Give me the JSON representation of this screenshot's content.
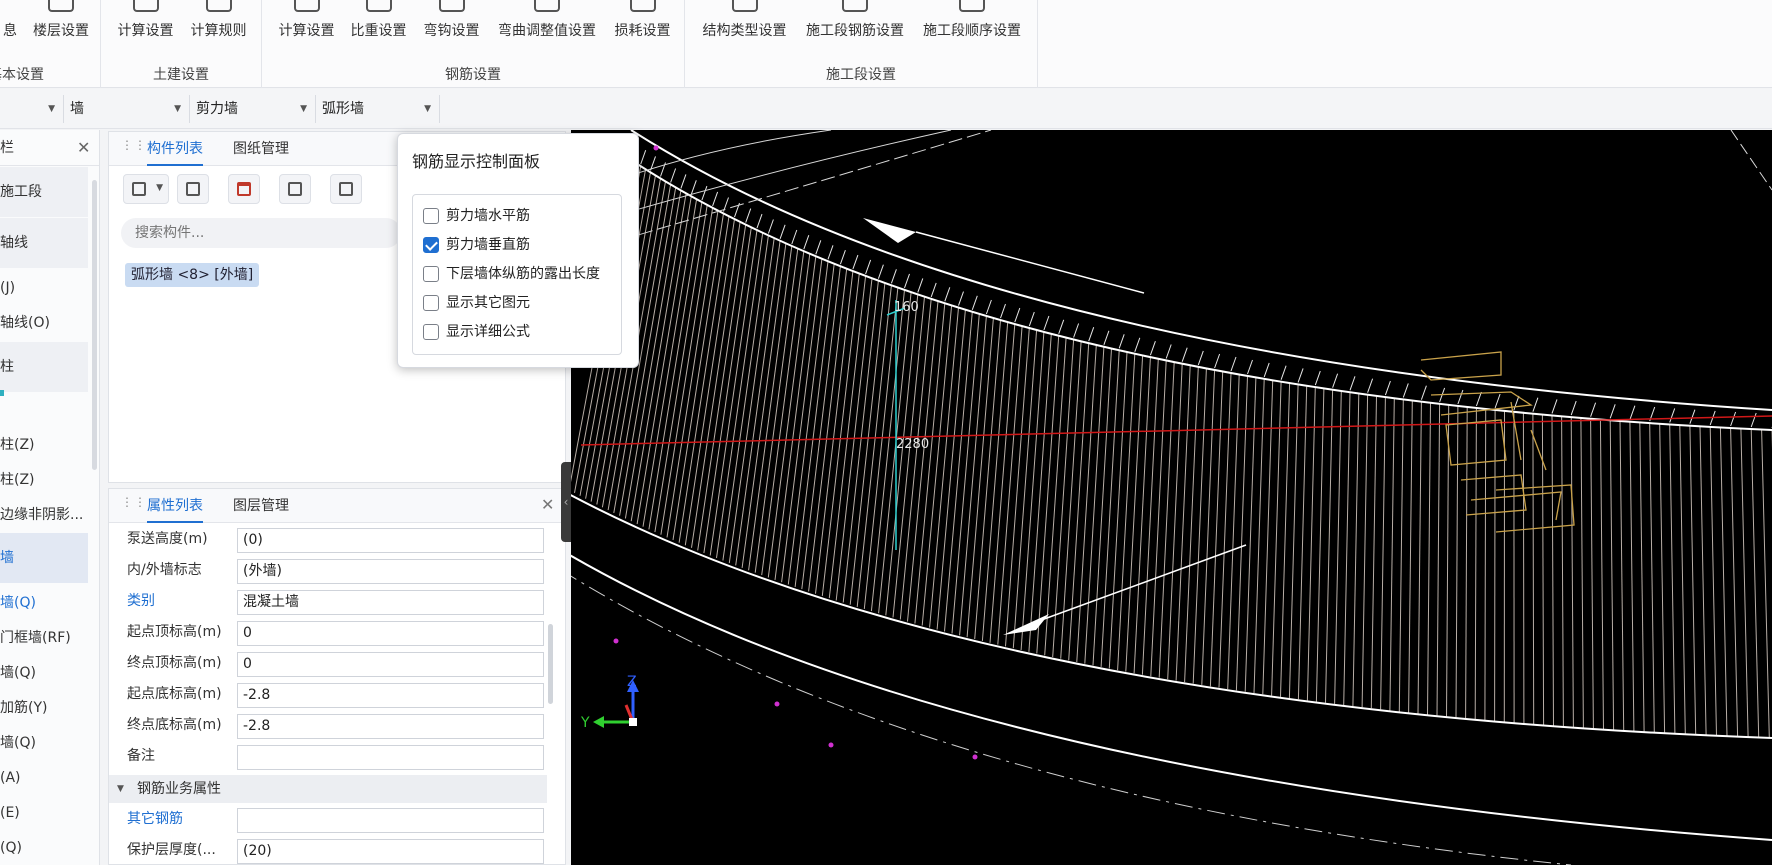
{
  "ribbon": {
    "groups": [
      {
        "label": "基本设置",
        "buttons": [
          "息",
          "楼层设置"
        ]
      },
      {
        "label": "土建设置",
        "buttons": [
          "计算设置",
          "计算规则"
        ]
      },
      {
        "label": "钢筋设置",
        "buttons": [
          "计算设置",
          "比重设置",
          "弯钩设置",
          "弯曲调整值设置",
          "损耗设置"
        ]
      },
      {
        "label": "施工段设置",
        "buttons": [
          "结构类型设置",
          "施工段钢筋设置",
          "施工段顺序设置"
        ]
      }
    ]
  },
  "filterbar": {
    "selects": [
      "",
      "墙",
      "剪力墙",
      "弧形墙"
    ]
  },
  "leftnav": {
    "title": "栏",
    "items": [
      {
        "label": "施工段",
        "kind": "cat"
      },
      {
        "label": "轴线",
        "kind": "cat"
      },
      {
        "label": "(J)",
        "kind": "item"
      },
      {
        "label": "轴线(O)",
        "kind": "item"
      },
      {
        "label": "柱",
        "kind": "cat"
      },
      {
        "label": "柱(Z)",
        "kind": "item"
      },
      {
        "label": "柱(Z)",
        "kind": "item"
      },
      {
        "label": "边缘非阴影...",
        "kind": "item"
      },
      {
        "label": "墙",
        "kind": "catsel"
      },
      {
        "label": "墙(Q)",
        "kind": "blue"
      },
      {
        "label": "门框墙(RF)",
        "kind": "item"
      },
      {
        "label": "墙(Q)",
        "kind": "item"
      },
      {
        "label": "加筋(Y)",
        "kind": "item"
      },
      {
        "label": "墙(Q)",
        "kind": "item"
      },
      {
        "label": "(A)",
        "kind": "item"
      },
      {
        "label": "(E)",
        "kind": "item"
      },
      {
        "label": "(Q)",
        "kind": "item"
      }
    ]
  },
  "component_panel": {
    "tabs": [
      "构件列表",
      "图纸管理"
    ],
    "search_placeholder": "搜索构件...",
    "selected_component": "弧形墙 <8> [外墙]"
  },
  "property_panel": {
    "tabs": [
      "属性列表",
      "图层管理"
    ],
    "rows": [
      {
        "label": "泵送高度(m)",
        "value": "(0)",
        "blue": false
      },
      {
        "label": "内/外墙标志",
        "value": "(外墙)",
        "blue": false
      },
      {
        "label": "类别",
        "value": "混凝土墙",
        "blue": true
      },
      {
        "label": "起点顶标高(m)",
        "value": "0",
        "blue": false
      },
      {
        "label": "终点顶标高(m)",
        "value": "0",
        "blue": false
      },
      {
        "label": "起点底标高(m)",
        "value": "-2.8",
        "blue": false
      },
      {
        "label": "终点底标高(m)",
        "value": "-2.8",
        "blue": false
      },
      {
        "label": "备注",
        "value": "",
        "blue": false
      }
    ],
    "section": "钢筋业务属性",
    "rows2": [
      {
        "label": "其它钢筋",
        "value": "",
        "blue": true
      },
      {
        "label": "保护层厚度(...",
        "value": "(20)",
        "blue": false
      }
    ]
  },
  "rebar_popup": {
    "title": "钢筋显示控制面板",
    "options": [
      {
        "label": "剪力墙水平筋",
        "checked": false
      },
      {
        "label": "剪力墙垂直筋",
        "checked": true
      },
      {
        "label": "下层墙体纵筋的露出长度",
        "checked": false
      },
      {
        "label": "显示其它图元",
        "checked": false
      },
      {
        "label": "显示详细公式",
        "checked": false
      }
    ]
  },
  "viewport": {
    "dim_label_1": "160",
    "dim_label_2": "2280",
    "axis_z": "Z",
    "axis_y": "Y",
    "colors": {
      "background": "#000000",
      "rebar": "#b8aea6",
      "outline": "#ffffff",
      "axis_red": "#d01818",
      "cyan": "#2fd0d0",
      "magenta": "#d030d0",
      "annotation_yellow": "#c9a24a"
    }
  }
}
